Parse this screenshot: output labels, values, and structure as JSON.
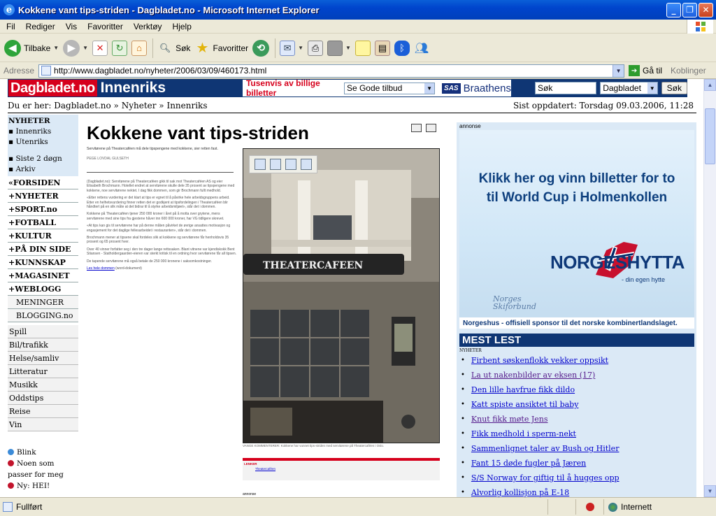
{
  "window": {
    "title": "Kokkene vant tips-striden - Dagbladet.no - Microsoft Internet Explorer"
  },
  "menu": [
    "Fil",
    "Rediger",
    "Vis",
    "Favoritter",
    "Verktøy",
    "Hjelp"
  ],
  "toolbar": {
    "back_label": "Tilbake",
    "search_label": "Søk",
    "favorites_label": "Favoritter"
  },
  "address": {
    "label": "Adresse",
    "url": "http://www.dagbladet.no/nyheter/2006/03/09/460173.html",
    "go_label": "Gå til",
    "links_label": "Koblinger"
  },
  "site": {
    "logo": "Dagbladet.no",
    "section": "Innenriks",
    "ad_text": "Tusenvis av billige billetter",
    "ad_select": "Se Gode tilbud",
    "ad_brand_box": "SAS",
    "ad_brand": "Braathens",
    "search_value": "Søk",
    "search_select": "Dagbladet",
    "search_button": "Søk"
  },
  "breadcrumb": {
    "text": "Du er her: Dagbladet.no » Nyheter » Innenriks",
    "updated": "Sist oppdatert: Torsdag 09.03.2006, 11:28"
  },
  "leftnav": {
    "top_heading": "NYHETER",
    "top_items": [
      "▪ Innenriks",
      "▪ Utenriks",
      "▪ Siste 2 døgn",
      "▪ Arkiv"
    ],
    "sections": [
      "«FORSIDEN",
      "+NYHETER",
      "+SPORT.no",
      "+FOTBALL",
      "+KULTUR",
      "+PÅ DIN SIDE",
      "+KUNNSKAP",
      "+MAGASINET",
      "+WEBLOGG"
    ],
    "subitems": [
      "MENINGER",
      "BLOGGING.no"
    ],
    "plain": [
      "Spill",
      "Bil/trafikk",
      "Helse/samliv",
      "Litteratur",
      "Musikk",
      "Oddstips",
      "Reise",
      "Vin"
    ],
    "fav": [
      "Blink",
      "Noen som passer for meg",
      "Ny: HEI!"
    ]
  },
  "article": {
    "headline": "Kokkene vant tips-striden",
    "ingress": "Servitørene på Theatercaféen må dele tipspengene med kokkene, sier retten fast.",
    "byline": "PEGE LOVDAL GULSETH",
    "body": [
      "(Dagbladet.no): Servitørene på Theatercaféen gikk til sak mot Theatercaféen AS og eier Elisabeth Brochmann. Hotellet endret at servitørene skulle dele 35 prosent av tipspengene med kokkene, noe servitørene nektet. I dag fikk dommen, som gir Brochmann fullt medhold.",
      "«Etter rettens vurdering er det klart at tips er egnet til å påvirke hele arbeidsgruppens arbeid. Etter en helhetsvurdering finner retten det er godkjent at tipsfordelingen i Theatercaféen blir håndtert på en slik måte at det bidrar til å styrke arbeidsmiljøet», står det i dommen.",
      "Kokkene på Theatercaféen tjener 250 000 kroner i året på å motta over grytene, mens servitørene med sine tips fra gjestene håver inn 600 000 kroner, har VG tidligere skrevet.",
      "«At tips kan gis til servitørene har på denne måten påvirket de øvrige ansattes motivasjon og engasjement for det daglige fellesarbeidet i restauranten», står det i dommen.",
      "Brochmann mener at tipsene skal fordeles slik at kokkene og servitørene får henholdsvis 35 prosent og 65 prosent hver.",
      "Over 40 vinner forfatter seg i den tre dager lange rettssaken. Blant vitnene var kjendiskokk Bent Stiansen - Statholdergaarden-eieren var sterkt kritisk til en ordning hvor servitørene får all tipsen.",
      "De tapende servitørene må også betale de 250 000 kronene i saksomkostninger."
    ],
    "doc_link": "Les hele dommen",
    "doc_link_suffix": "(word-dokument)",
    "caption": "VANGE KOMMENTERER: Kokkene har vunnet tips-striden med servitørene på Theatercaféen i Oslo.",
    "links_title": "LENKER",
    "links_item": "Theatercaféen",
    "annonse_bottom": "annonse"
  },
  "rightcol": {
    "annonse": "annonse",
    "ad_line1": "Klikk her og vinn billetter for to",
    "ad_line2": "til World Cup i Holmenkollen",
    "ad_brand": "NORGESHYTTA",
    "ad_sub": "- din egen hytte",
    "ad_ski1": "Norges",
    "ad_ski2": "Skiforbund",
    "ad_foot": "Norgeshus - offisiell sponsor til det norske kombinertlandslaget.",
    "mest_lest": "MEST LEST",
    "mest_lest_section": "NYHETER",
    "items": [
      "Firbent søskenflokk vekker oppsikt",
      "La ut nakenbilder av eksen (17)",
      "Den lille havfrue fikk dildo",
      "Katt spiste ansiktet til baby",
      "Knut fikk møte Jens",
      "Fikk medhold i sperm-nekt",
      "Sammenlignet taler av Bush og Hitler",
      "Fant 15 døde fugler på Jæren",
      "S/S Norway for giftig til å hugges opp",
      "Alvorlig kollisjon på E-18"
    ]
  },
  "status": {
    "text": "Fullført",
    "zone": "Internett"
  }
}
